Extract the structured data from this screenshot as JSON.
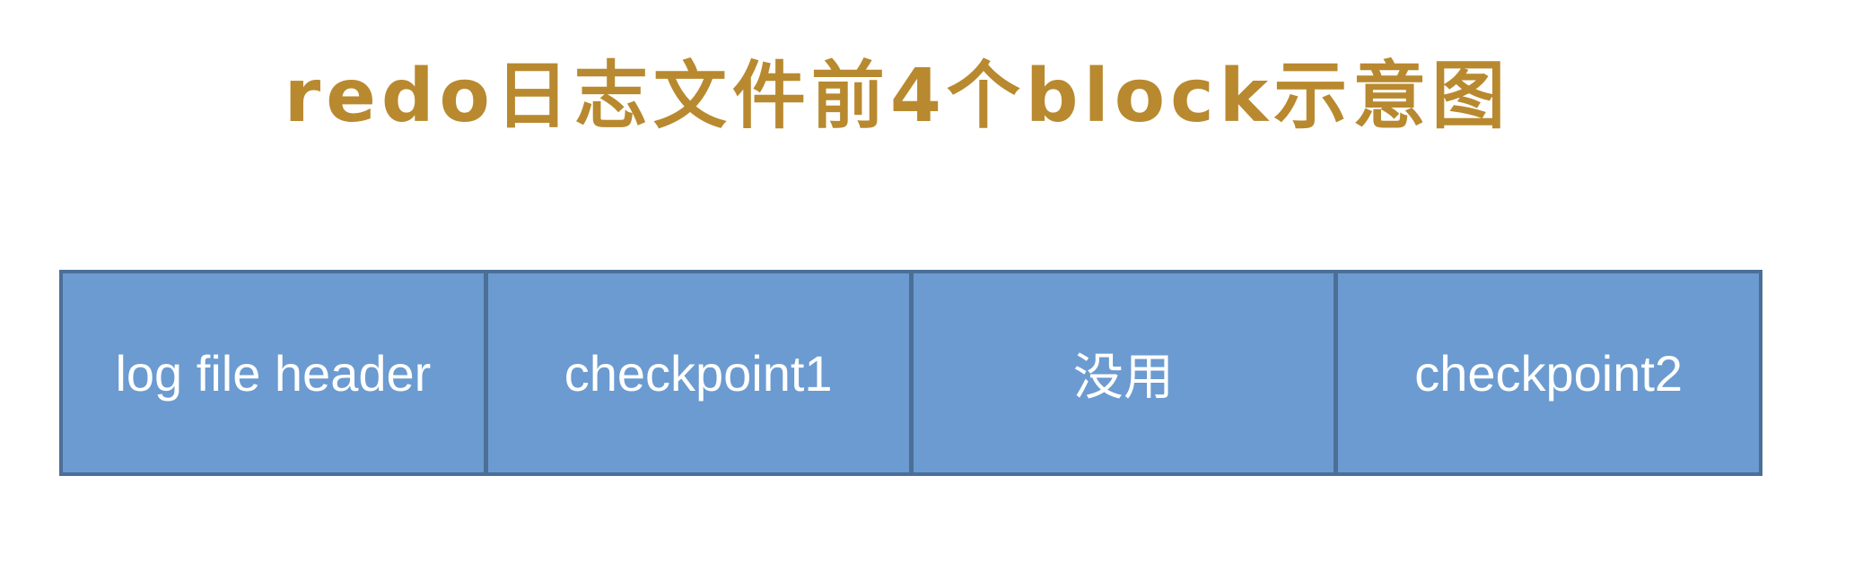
{
  "title": "redo日志文件前4个block示意图",
  "blocks": [
    {
      "label": "log file header"
    },
    {
      "label": "checkpoint1"
    },
    {
      "label": "没用"
    },
    {
      "label": "checkpoint2"
    }
  ],
  "colors": {
    "title": "#b8892f",
    "block_fill": "#6b9bd0",
    "block_border": "#4b6f97",
    "block_text": "#ffffff"
  }
}
